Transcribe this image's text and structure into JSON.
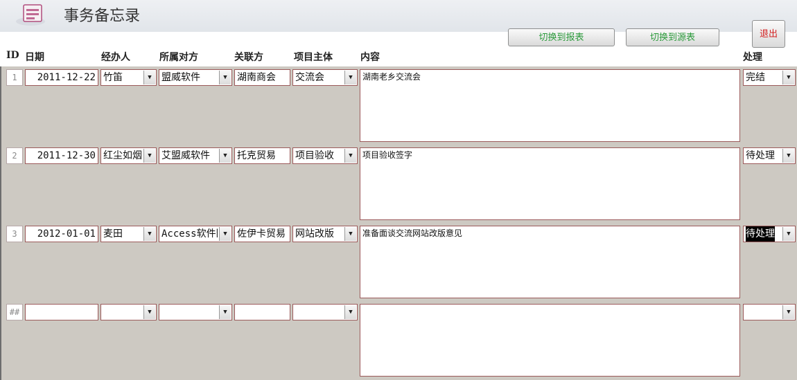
{
  "app": {
    "title": "事务备忘录",
    "icon": "form-icon"
  },
  "toolbar": {
    "report_label": "切换到报表",
    "source_label": "切换到源表",
    "exit_label": "退出"
  },
  "columns": {
    "id": "ID",
    "date": "日期",
    "agent": "经办人",
    "party": "所属对方",
    "related": "关联方",
    "subject": "项目主体",
    "content": "内容",
    "status": "处理"
  },
  "rows": [
    {
      "id": "1",
      "date": "2011-12-22",
      "agent": "竹笛",
      "party": "盟威软件",
      "related": "湖南商会",
      "subject": "交流会",
      "content": "湖南老乡交流会",
      "status": "完结"
    },
    {
      "id": "2",
      "date": "2011-12-30",
      "agent": "红尘如烟",
      "party": "艾盟威软件",
      "related": "托克贸易",
      "subject": "项目验收",
      "content": "项目验收签字",
      "status": "待处理"
    },
    {
      "id": "3",
      "date": "2012-01-01",
      "agent": "麦田",
      "party": "Access软件网",
      "related": "佐伊卡贸易",
      "subject": "网站改版",
      "content": "准备面谈交流网站改版意见",
      "status": "待处理"
    },
    {
      "id": "##",
      "date": "",
      "agent": "",
      "party": "",
      "related": "",
      "subject": "",
      "content": "",
      "status": ""
    }
  ]
}
